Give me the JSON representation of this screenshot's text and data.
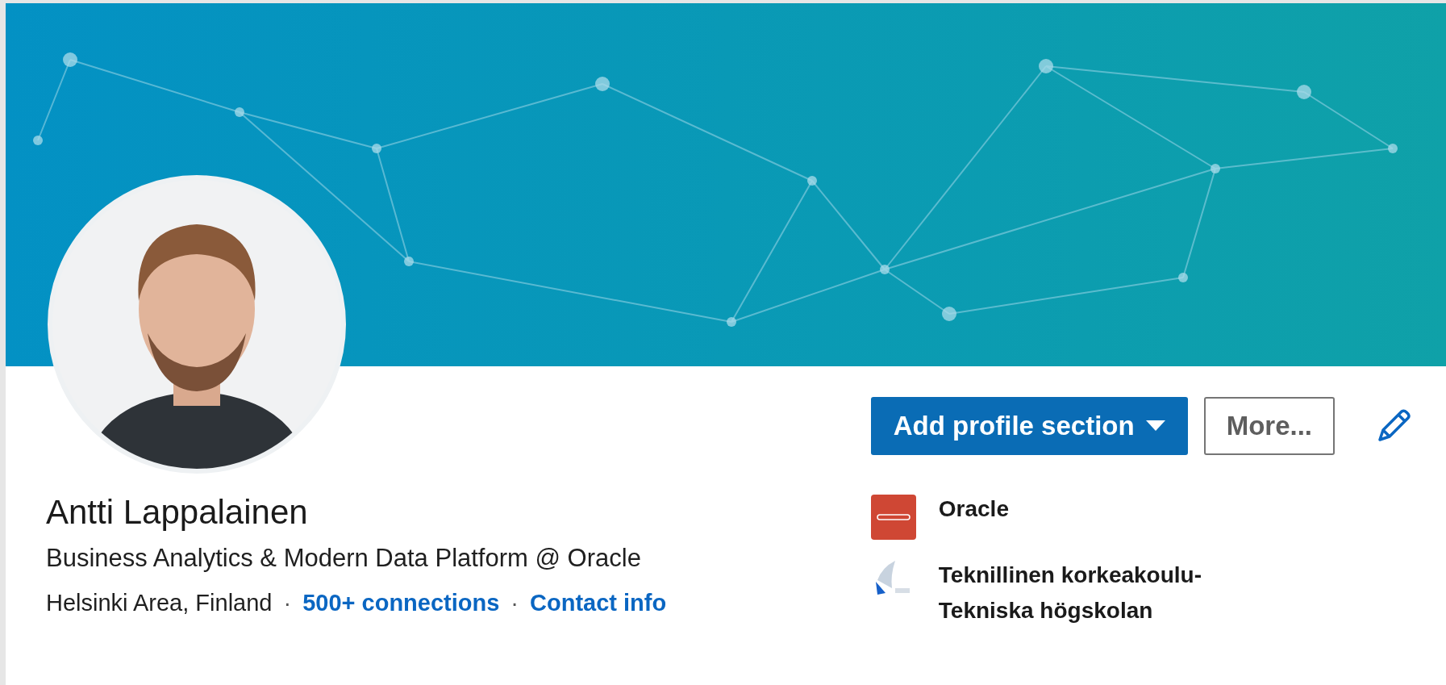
{
  "actions": [
    {
      "kind": "primary",
      "label": "Add profile section"
    },
    {
      "kind": "secondary",
      "label": "More..."
    },
    {
      "kind": "edit"
    }
  ],
  "profile": {
    "name": "Antti Lappalainen",
    "headline": "Business Analytics & Modern Data Platform @ Oracle",
    "meta": [
      {
        "kind": "text",
        "text": "Helsinki Area, Finland"
      },
      {
        "kind": "separator",
        "text": "·"
      },
      {
        "kind": "link",
        "text": "500+ connections"
      },
      {
        "kind": "separator",
        "text": "·"
      },
      {
        "kind": "link",
        "text": "Contact info"
      }
    ]
  },
  "highlights": [
    {
      "kind": "company",
      "label": "Oracle"
    },
    {
      "kind": "school",
      "label": "Teknillinen korkeakoulu-Tekniska högskolan"
    }
  ]
}
